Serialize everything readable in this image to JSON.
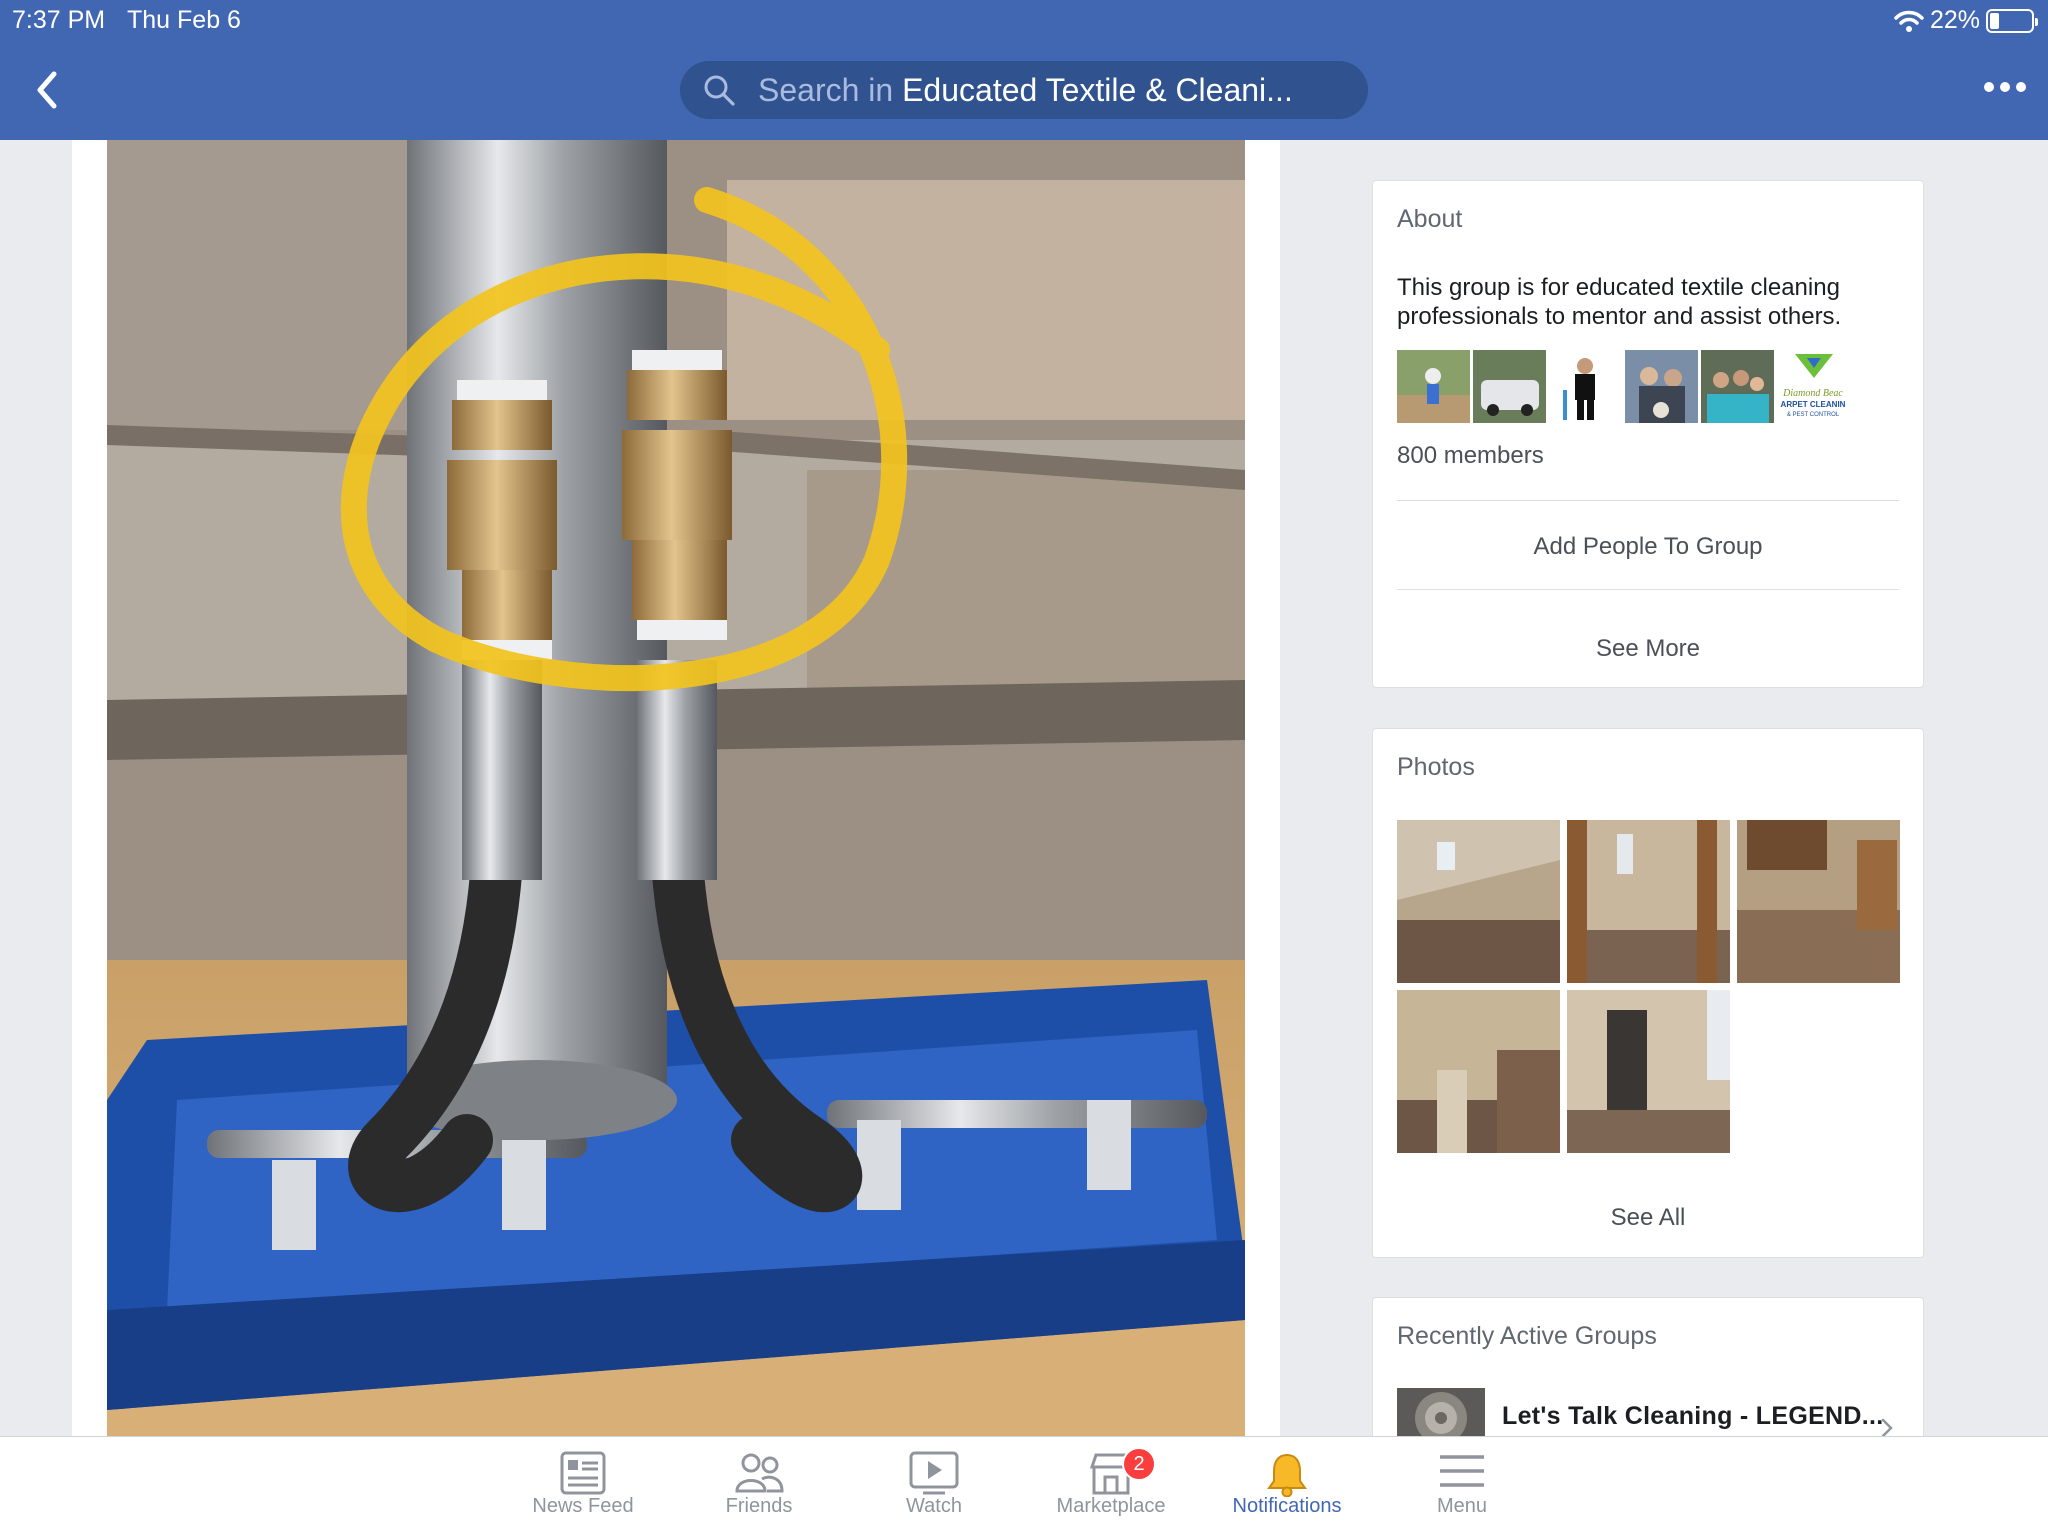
{
  "status_bar": {
    "time": "7:37 PM",
    "date": "Thu Feb 6",
    "battery": "22%",
    "battery_level": 0.22
  },
  "header": {
    "search_prefix": "Search in",
    "search_group": "Educated Textile & Cleani..."
  },
  "about": {
    "title": "About",
    "description": "This group is for educated textile cleaning professionals to mentor and assist others.",
    "members": "800 members",
    "add_people": "Add People To Group",
    "see_more": "See More",
    "avatars": [
      "avatar-baseball",
      "avatar-van",
      "avatar-man-black",
      "avatar-couple-dog",
      "avatar-family",
      "avatar-logo"
    ],
    "logo_text": [
      "Diamond Beac",
      "ARPET CLEANIN",
      "& PEST CONTROL"
    ]
  },
  "photos": {
    "title": "Photos",
    "see_all": "See All"
  },
  "recent_groups": {
    "title": "Recently Active Groups",
    "items": [
      {
        "name": "Let's Talk Cleaning - LEGEND..."
      }
    ]
  },
  "tabbar": {
    "tabs": [
      {
        "label": "News Feed",
        "icon": "news-feed-icon"
      },
      {
        "label": "Friends",
        "icon": "friends-icon"
      },
      {
        "label": "Watch",
        "icon": "watch-icon"
      },
      {
        "label": "Marketplace",
        "icon": "marketplace-icon",
        "badge": "2"
      },
      {
        "label": "Notifications",
        "icon": "bell-icon",
        "active": true
      },
      {
        "label": "Menu",
        "icon": "menu-icon"
      }
    ]
  },
  "colors": {
    "brand": "#4267b2",
    "search_bg": "#30528f",
    "badge": "#fa3e3e",
    "highlight_circle": "#f2c31d"
  }
}
